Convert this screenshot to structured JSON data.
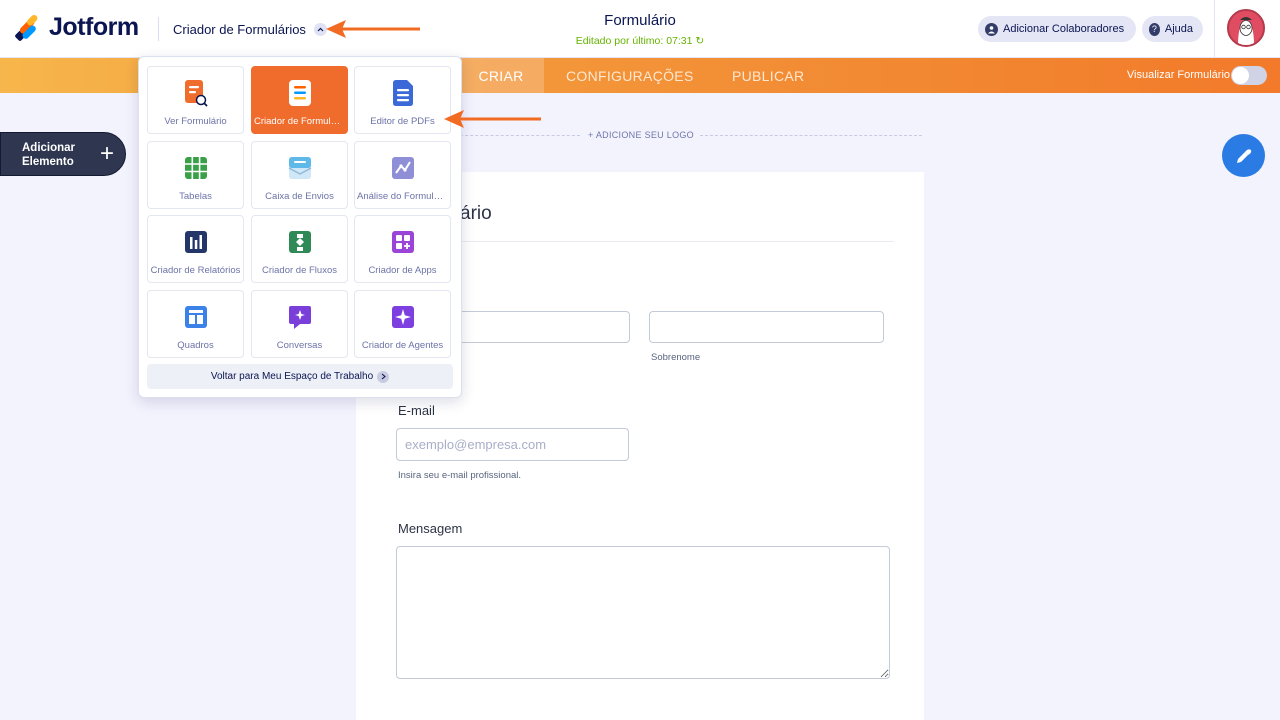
{
  "header": {
    "brand": "Jotform",
    "app_switcher": "Criador de Formulários",
    "form_title": "Formulário",
    "edited": "Editado por último: 07:31",
    "collaborators": "Adicionar Colaboradores",
    "help": "Ajuda"
  },
  "tabs": [
    {
      "label": "CRIAR"
    },
    {
      "label": "CONFIGURAÇÕES"
    },
    {
      "label": "PUBLICAR"
    }
  ],
  "preview_label": "Visualizar Formulário",
  "add_element": {
    "label": "Adicionar Elemento",
    "plus": "+"
  },
  "logo_placeholder": "+ ADICIONE SEU LOGO",
  "form": {
    "title_partial": "ário",
    "last_name_label": "Sobrenome",
    "email_label": "E-mail",
    "email_placeholder": "exemplo@empresa.com",
    "email_hint": "Insira seu e-mail profissional.",
    "message_label": "Mensagem"
  },
  "apps_menu": {
    "items": [
      {
        "label": "Ver Formulário",
        "icon": "view-form-icon",
        "color": "#f06c2c"
      },
      {
        "label": "Criador de Formulários",
        "icon": "form-builder-icon",
        "color": "#ffffff",
        "active": true
      },
      {
        "label": "Editor de PDFs",
        "icon": "pdf-editor-icon",
        "color": "#3b6ad8"
      },
      {
        "label": "Tabelas",
        "icon": "tables-icon",
        "color": "#3aa048"
      },
      {
        "label": "Caixa de Envios",
        "icon": "inbox-icon",
        "color": "#5eb8e8"
      },
      {
        "label": "Análise do Formulário",
        "icon": "analytics-icon",
        "color": "#8f8fd8"
      },
      {
        "label": "Criador de Relatórios",
        "icon": "report-builder-icon",
        "color": "#243569"
      },
      {
        "label": "Criador de Fluxos",
        "icon": "workflow-icon",
        "color": "#2f8a57"
      },
      {
        "label": "Criador de Apps",
        "icon": "app-builder-icon",
        "color": "#9b44d8"
      },
      {
        "label": "Quadros",
        "icon": "boards-icon",
        "color": "#3b82e8"
      },
      {
        "label": "Conversas",
        "icon": "conversations-icon",
        "color": "#7a3fd8"
      },
      {
        "label": "Criador de Agentes",
        "icon": "agent-builder-icon",
        "color": "#7d3fe0"
      }
    ],
    "back_to_workspace": "Voltar para Meu Espaço de Trabalho"
  },
  "colors": {
    "accent": "#f06c2c",
    "callout_arrow": "#f26b22",
    "navy": "#0a1551",
    "edited_green": "#64b200",
    "brush_button": "#2b7be5"
  }
}
